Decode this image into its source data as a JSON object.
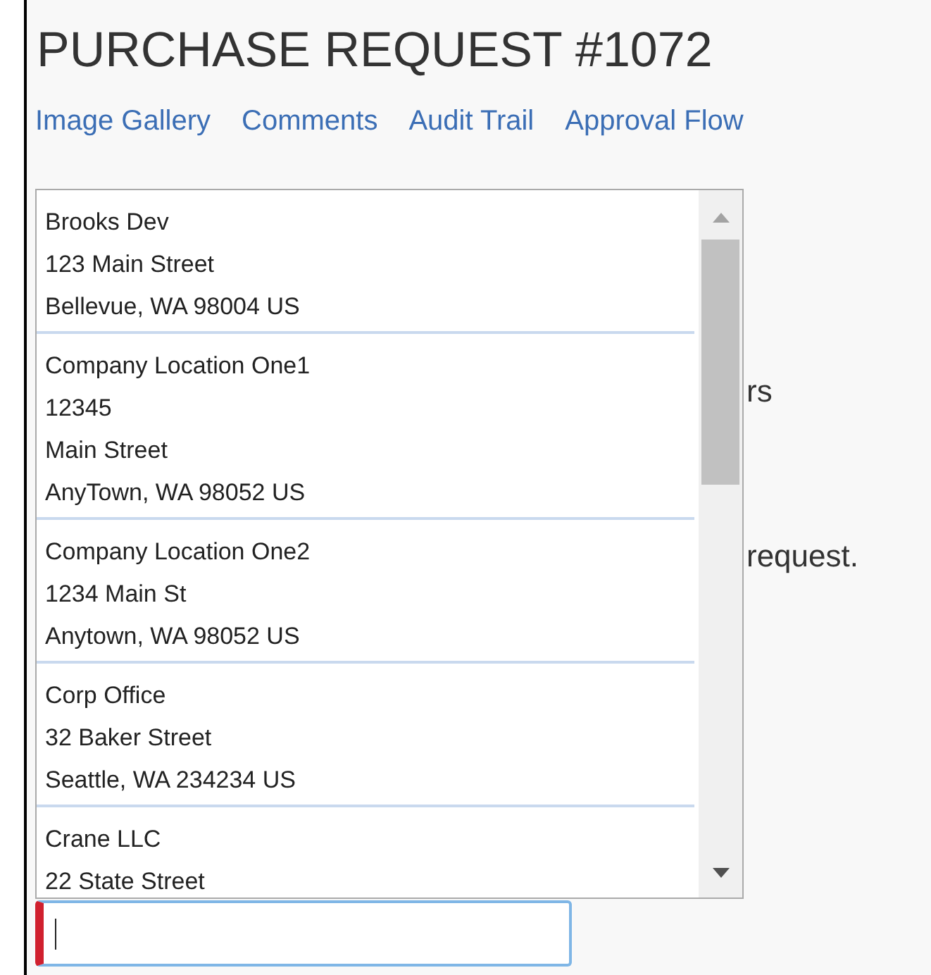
{
  "title": "PURCHASE REQUEST #1072",
  "links": [
    "Image Gallery",
    "Comments",
    "Audit Trail",
    "Approval Flow"
  ],
  "background_texts": [
    "rs",
    "request."
  ],
  "address_dropdown": {
    "options": [
      {
        "lines": [
          "Brooks Dev",
          "123 Main Street",
          "Bellevue, WA 98004 US"
        ]
      },
      {
        "lines": [
          "Company Location One1",
          "12345",
          "Main Street",
          "AnyTown, WA 98052 US"
        ]
      },
      {
        "lines": [
          "Company Location One2",
          "1234 Main St",
          "Anytown, WA 98052 US"
        ]
      },
      {
        "lines": [
          "Corp Office",
          "32 Baker Street",
          "Seattle, WA 234234 US"
        ]
      },
      {
        "lines": [
          "Crane LLC",
          "22 State Street"
        ]
      }
    ]
  },
  "address_field": {
    "required": true
  }
}
